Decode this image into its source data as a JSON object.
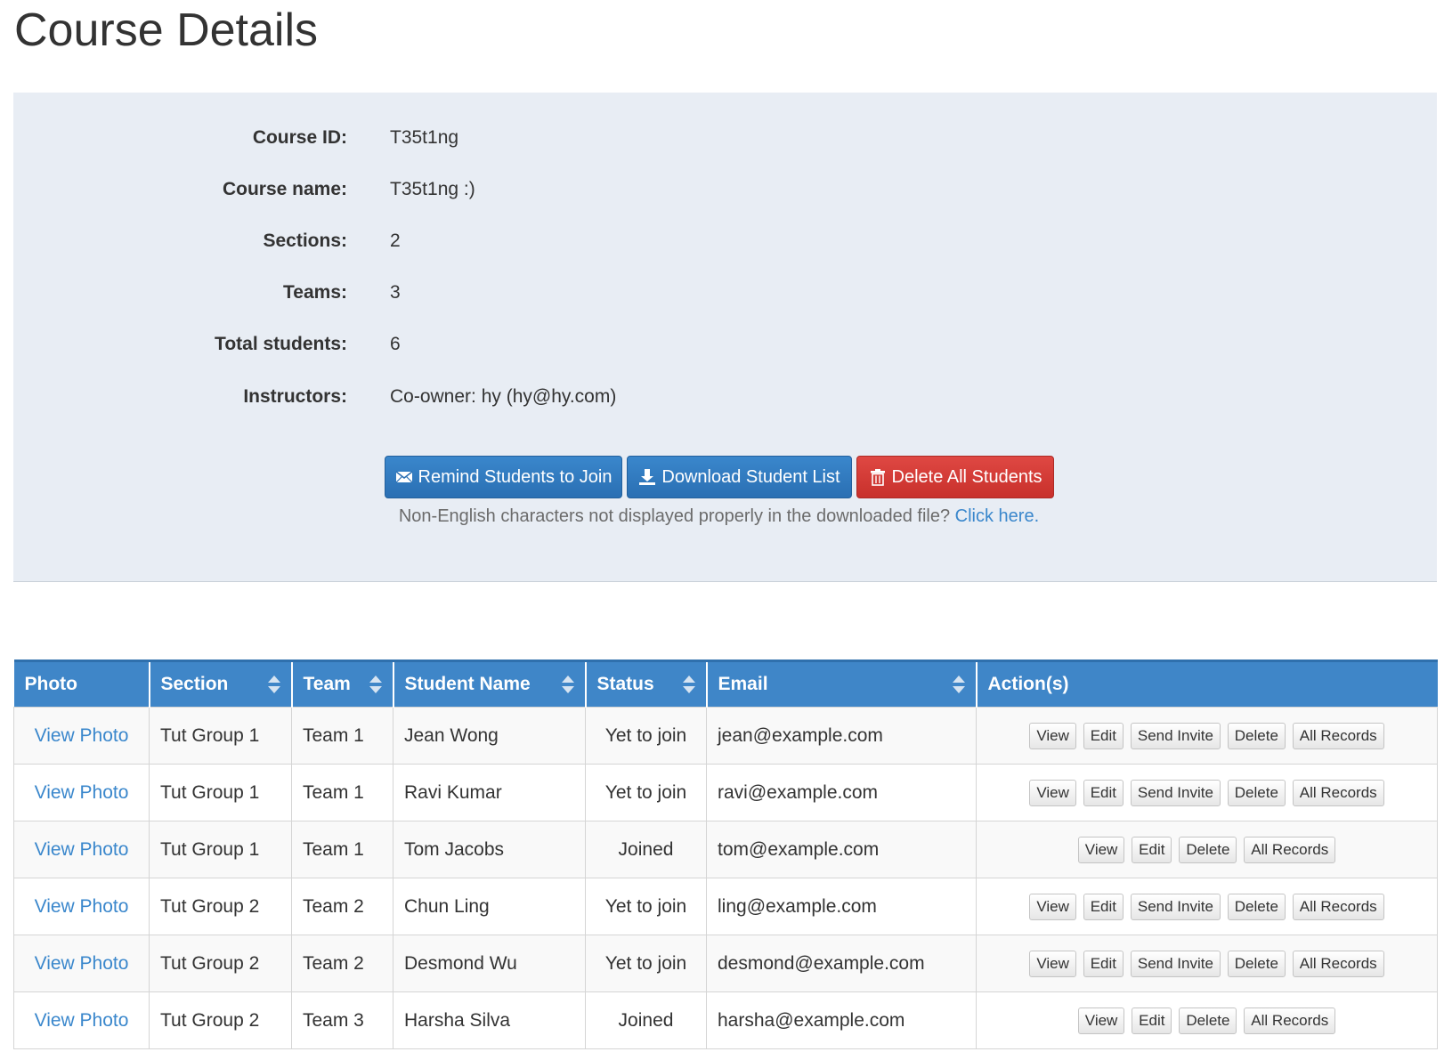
{
  "page": {
    "title": "Course Details"
  },
  "course_info": [
    {
      "label": "Course ID:",
      "value": "T35t1ng"
    },
    {
      "label": "Course name:",
      "value": "T35t1ng :)"
    },
    {
      "label": "Sections:",
      "value": "2"
    },
    {
      "label": "Teams:",
      "value": "3"
    },
    {
      "label": "Total students:",
      "value": "6"
    },
    {
      "label": "Instructors:",
      "value": "Co-owner: hy (hy@hy.com)"
    }
  ],
  "buttons": {
    "remind": {
      "label": "Remind Students to Join",
      "icon": "envelope-icon"
    },
    "download": {
      "label": "Download Student List",
      "icon": "download-icon"
    },
    "delete_all": {
      "label": "Delete All Students",
      "icon": "trash-icon"
    }
  },
  "help": {
    "text": "Non-English characters not displayed properly in the downloaded file? ",
    "link": "Click here."
  },
  "colors": {
    "primary": "#3a87cc",
    "danger": "#d9413c",
    "panel": "#e8edf4",
    "header": "#3f86c8"
  },
  "table": {
    "headers": [
      "Photo",
      "Section",
      "Team",
      "Student Name",
      "Status",
      "Email",
      "Action(s)"
    ],
    "rows": [
      {
        "photo": "View Photo",
        "section": "Tut Group 1",
        "team": "Team 1",
        "name": "Jean Wong",
        "status": "Yet to join",
        "email": "jean@example.com",
        "actions": [
          "View",
          "Edit",
          "Send Invite",
          "Delete",
          "All Records"
        ]
      },
      {
        "photo": "View Photo",
        "section": "Tut Group 1",
        "team": "Team 1",
        "name": "Ravi Kumar",
        "status": "Yet to join",
        "email": "ravi@example.com",
        "actions": [
          "View",
          "Edit",
          "Send Invite",
          "Delete",
          "All Records"
        ]
      },
      {
        "photo": "View Photo",
        "section": "Tut Group 1",
        "team": "Team 1",
        "name": "Tom Jacobs",
        "status": "Joined",
        "email": "tom@example.com",
        "actions": [
          "View",
          "Edit",
          "Delete",
          "All Records"
        ]
      },
      {
        "photo": "View Photo",
        "section": "Tut Group 2",
        "team": "Team 2",
        "name": "Chun Ling",
        "status": "Yet to join",
        "email": "ling@example.com",
        "actions": [
          "View",
          "Edit",
          "Send Invite",
          "Delete",
          "All Records"
        ]
      },
      {
        "photo": "View Photo",
        "section": "Tut Group 2",
        "team": "Team 2",
        "name": "Desmond Wu",
        "status": "Yet to join",
        "email": "desmond@example.com",
        "actions": [
          "View",
          "Edit",
          "Send Invite",
          "Delete",
          "All Records"
        ]
      },
      {
        "photo": "View Photo",
        "section": "Tut Group 2",
        "team": "Team 3",
        "name": "Harsha Silva",
        "status": "Joined",
        "email": "harsha@example.com",
        "actions": [
          "View",
          "Edit",
          "Delete",
          "All Records"
        ]
      }
    ]
  }
}
